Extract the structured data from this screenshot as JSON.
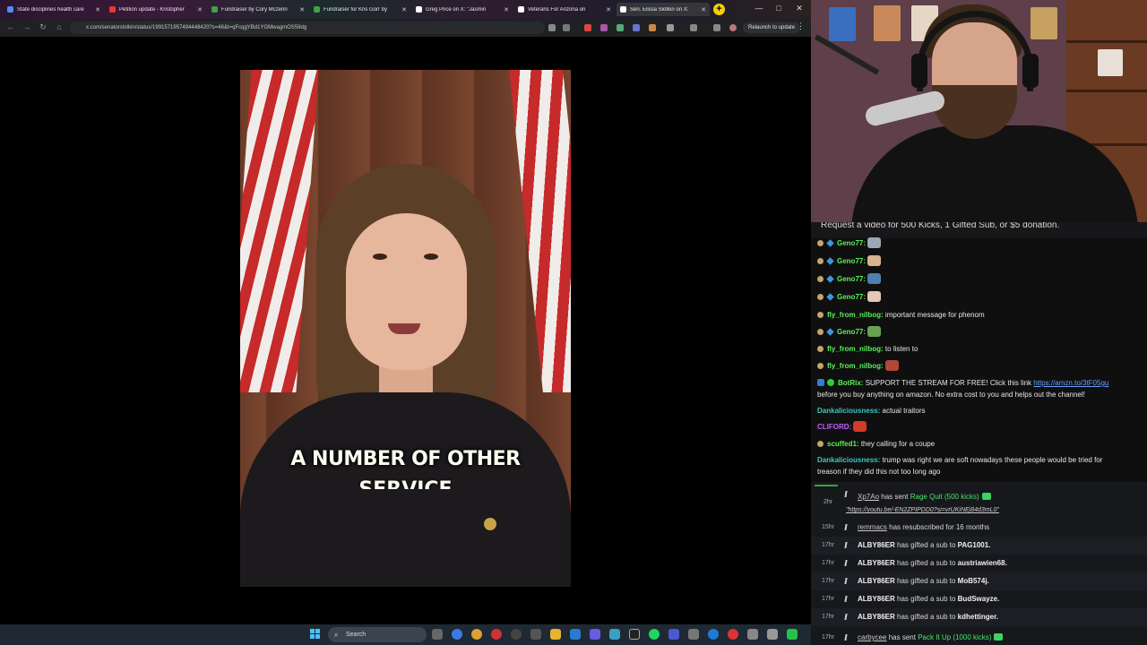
{
  "browser": {
    "tabs": [
      {
        "title": "State disciplines health care",
        "color": "#4c8df6"
      },
      {
        "title": "Petition update - Kristopher",
        "color": "#e53935"
      },
      {
        "title": "Fundraiser by Cory Mczenn",
        "color": "#43a047"
      },
      {
        "title": "Fundraiser for Kris Gorr by",
        "color": "#43a047"
      },
      {
        "title": "Greg Price on X: \"Jasmin",
        "color": "#ffffff"
      },
      {
        "title": "Veterans For Arizona on",
        "color": "#ffffff"
      },
      {
        "title": "Sen. Elissa Slotkin on X:",
        "color": "#ffffff"
      }
    ],
    "new_tab": "+",
    "window_controls": {
      "minimize": "—",
      "maximize": "□",
      "close": "✕"
    },
    "url": "x.com/senatorslotkin/status/1991571957494448420?s=46&t=qFcqgYBd1YGMwagmOS59dg",
    "relaunch_label": "Relaunch to update",
    "kebab": "⋮"
  },
  "video": {
    "caption_line1": "A NUMBER OF OTHER",
    "caption_line2": "SERVICE"
  },
  "taskbar": {
    "search_label": "Search"
  },
  "chat": {
    "banner": "Request a video for 500 Kicks, 1 Gifted Sub, or $5 donation.",
    "messages": [
      {
        "user": "Geno77",
        "text": "",
        "color": "#5af05a",
        "emote": "#9aa8b8"
      },
      {
        "user": "Geno77",
        "text": "",
        "color": "#5af05a",
        "emote": "#d9b38c"
      },
      {
        "user": "Geno77",
        "text": "",
        "color": "#5af05a",
        "emote": "#4e7fb0"
      },
      {
        "user": "Geno77",
        "text": "",
        "color": "#5af05a",
        "emote": "#e5c7b5"
      },
      {
        "user": "fly_from_nilbog",
        "text": "important message for phenom",
        "color": "#5af05a"
      },
      {
        "user": "Geno77",
        "text": "",
        "color": "#5af05a",
        "emote": "#6aa050"
      },
      {
        "user": "fly_from_nilbog",
        "text": "to listen to",
        "color": "#5af05a"
      },
      {
        "user": "fly_from_nilbog",
        "text": "",
        "color": "#5af05a",
        "emote": "#b04838"
      },
      {
        "user": "BotRix",
        "text": "SUPPORT THE STREAM FOR FREE! Click this link",
        "link": "https://amzn.to/3tF05gu",
        "text2": "before you buy anything on amazon. No extra cost to you and helps out the channel!",
        "color": "#5af05a"
      },
      {
        "user": "Dankaliciousness",
        "text": "actual traitors",
        "color": "#3fc6c0"
      },
      {
        "user": "CLIFORD",
        "text": "",
        "color": "#c060ff",
        "emote": "#d23a2a"
      },
      {
        "user": "scuffed1",
        "text": "they calling for a coupe",
        "color": "#5af05a"
      },
      {
        "user": "Dankaliciousness",
        "text": "trump was right we are soft nowadays these people would be tried for",
        "text2": "treason if they did this not too long ago",
        "color": "#3fc6c0"
      }
    ]
  },
  "events": [
    {
      "time": "2hr",
      "name": "Xp7Ao",
      "action": "has sent",
      "item": "Rage Quit (500 kicks)",
      "link": "\"https://youtu.be/-EN2ZPIPDD0?si=vrUKiNEj84d3mL0\""
    },
    {
      "time": "15hr",
      "name": "remmacs",
      "action": "has resubscribed for 16 months"
    },
    {
      "time": "17hr",
      "name": "ALBY86ER",
      "action": "has gifted a sub to",
      "target": "PAG1001."
    },
    {
      "time": "17hr",
      "name": "ALBY86ER",
      "action": "has gifted a sub to",
      "target": "austriawien68."
    },
    {
      "time": "17hr",
      "name": "ALBY86ER",
      "action": "has gifted a sub to",
      "target": "MoB574j."
    },
    {
      "time": "17hr",
      "name": "ALBY86ER",
      "action": "has gifted a sub to",
      "target": "BudSwayze."
    },
    {
      "time": "17hr",
      "name": "ALBY86ER",
      "action": "has gifted a sub to",
      "target": "kdhettinger."
    },
    {
      "time": "17hr",
      "name": "carbycee",
      "action": "has sent",
      "item": "Pack It Up (1000 kicks)"
    }
  ]
}
